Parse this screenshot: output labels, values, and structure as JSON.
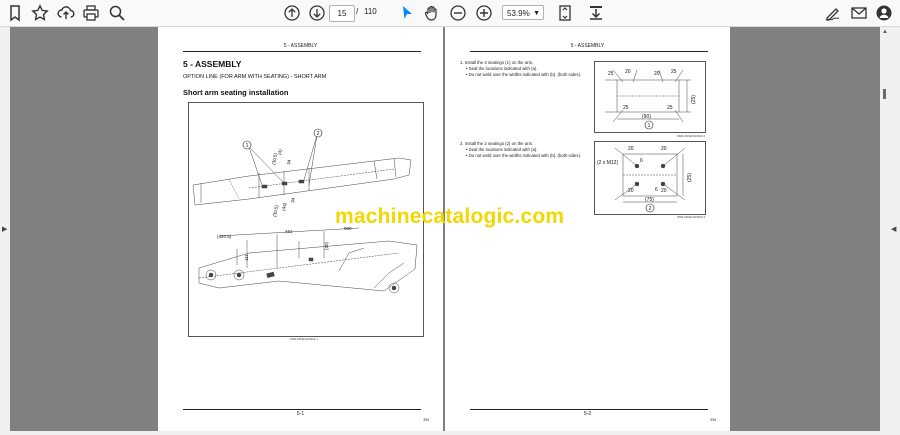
{
  "toolbar": {
    "page_current": "15",
    "page_separator": "/",
    "page_total": "110",
    "zoom": "53.9%"
  },
  "page1": {
    "header": "5 - ASSEMBLY",
    "section_title": "5 - ASSEMBLY",
    "option_line": "OPTION LINE (FOR ARM WITH SEATING) - SHORT ARM",
    "subtitle": "Short arm seating installation",
    "figure_caption": "SMIL15DEX2FR02     1",
    "callouts": [
      "1",
      "2"
    ],
    "dims": [
      "(4)",
      "(30.5)",
      "34",
      "(44)",
      "(30.5)",
      "34",
      "(420.5)",
      "461",
      "960",
      "111",
      "(30)"
    ],
    "footer": "5-1",
    "footer_lang": "EN"
  },
  "page2": {
    "header": "5 - ASSEMBLY",
    "step1": {
      "num": "1.",
      "text": "Install the 2 seatings (1) on the arm.",
      "sub1": "Seal the locations indicated with (a).",
      "sub2": "Do not weld over the widths indicated with (b). (both sides)."
    },
    "step2": {
      "num": "2.",
      "text": "Install the 2 seatings (2) on the arm.",
      "sub1": "Seal the locations indicated with (a).",
      "sub2": "Do not weld over the widths indicated with (b). (both sides)."
    },
    "fig1": {
      "dims": [
        "20",
        "25",
        "25",
        "20",
        "(25)",
        "25",
        "25",
        "(90)"
      ],
      "label": "1",
      "caption": "SMIL15DEX2FR03     2"
    },
    "fig2": {
      "dims": [
        "20",
        "20",
        "(2 x M12)",
        "6",
        "6",
        "(25)",
        "20",
        "20",
        "(75)"
      ],
      "label": "2",
      "caption": "SMIL15DEX2FR04     3"
    },
    "footer": "5-2",
    "footer_lang": "EN"
  },
  "watermark": "machinecatalogic.com",
  "colors": {
    "viewer_bg": "#808080",
    "toolbar_bg": "#f9f9fa",
    "pointer_active": "#0a84ff",
    "watermark": "#f0d800"
  },
  "icons": [
    "bookmark-icon",
    "star-icon",
    "upload-icon",
    "print-icon",
    "search-icon",
    "arrow-up-icon",
    "arrow-down-icon",
    "pointer-icon",
    "hand-icon",
    "zoom-out-icon",
    "zoom-in-icon",
    "fit-page-icon",
    "download-icon",
    "sign-icon",
    "mail-icon",
    "account-icon"
  ]
}
